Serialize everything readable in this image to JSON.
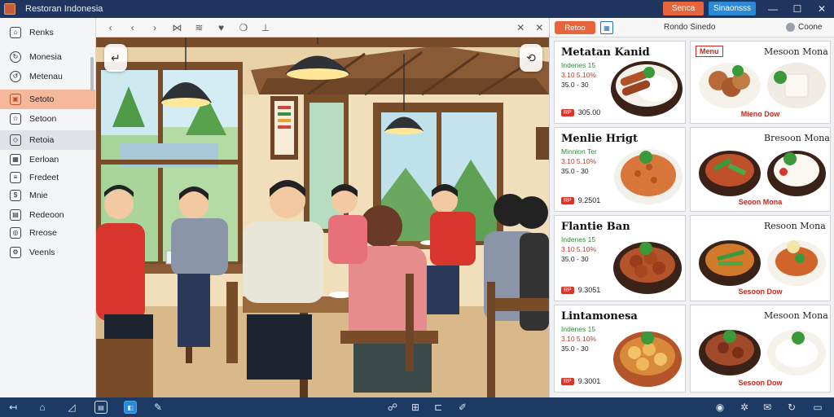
{
  "window": {
    "title": "Restoran Indonesia",
    "btn_orange": "Senca",
    "btn_blue": "Sinaonsss",
    "controls": [
      "—",
      "☐",
      "✕"
    ]
  },
  "sidebar": {
    "items": [
      {
        "label": "Renks",
        "icon": "home-icon",
        "state": "normal"
      },
      {
        "label": "Monesia",
        "icon": "refresh-icon",
        "state": "normal"
      },
      {
        "label": "Metenau",
        "icon": "reload-icon",
        "state": "normal"
      },
      {
        "label": "Setoto",
        "icon": "bag-icon",
        "state": "active"
      },
      {
        "label": "Setoon",
        "icon": "star-icon",
        "state": "normal"
      },
      {
        "label": "Retoia",
        "icon": "tag-icon",
        "state": "hover"
      },
      {
        "label": "Eerloan",
        "icon": "grid-icon",
        "state": "normal"
      },
      {
        "label": "Fredeet",
        "icon": "document-icon",
        "state": "normal"
      },
      {
        "label": "Mnie",
        "icon": "dollar-icon",
        "state": "normal"
      },
      {
        "label": "Redeoon",
        "icon": "calendar-icon",
        "state": "normal"
      },
      {
        "label": "Rreose",
        "icon": "user-icon",
        "state": "normal"
      },
      {
        "label": "Veenls",
        "icon": "settings-icon",
        "state": "normal"
      }
    ]
  },
  "center_toolbar": {
    "icons": [
      "back-arrow-icon",
      "chevron-left-icon",
      "chevron-right-icon",
      "split-icon",
      "equals-icon",
      "heart-icon",
      "chat-icon",
      "pin-icon"
    ],
    "right_icons": [
      "close-x-icon",
      "close-icon"
    ]
  },
  "scene": {
    "alt_label": "Indonesian restaurant interior illustration"
  },
  "right_panel": {
    "toolbar": {
      "pill": "Retoo",
      "title": "Rondo Sinedo",
      "right": "Coone"
    },
    "cards": [
      {
        "col": "left",
        "name": "Metatan Kanid",
        "desc1": "Indenes 15",
        "desc2": "3.10 5.10%",
        "desc3": "35.0 - 30",
        "price": "305.00"
      },
      {
        "col": "right",
        "tag": "Menu",
        "subname": "Mesoon Mona",
        "stamp": "Mieno Dow"
      },
      {
        "col": "left",
        "name": "Menlie Hrigt",
        "desc1": "Minnion Ter",
        "desc2": "3.10 5.10%",
        "desc3": "35.0 - 30",
        "price": "9.2501"
      },
      {
        "col": "right",
        "subname": "Bresoon Mona",
        "stamp": "Seoon Mona"
      },
      {
        "col": "left",
        "name": "Flantie Ban",
        "desc1": "Indenes 15",
        "desc2": "3.10 5.10%",
        "desc3": "35.0 - 30",
        "price": "9.3051"
      },
      {
        "col": "right",
        "subname": "Resoon Mona",
        "stamp": "Sesoon Dow"
      },
      {
        "col": "left",
        "name": "Lintamonesa",
        "desc1": "Indenes 15",
        "desc2": "3.10 5.10%",
        "desc3": "35.0 - 30",
        "price": "9.3001"
      },
      {
        "col": "right",
        "subname": "Mesoon Mona",
        "stamp": "Sesoon Dow"
      }
    ]
  },
  "taskbar": {
    "left_icons": [
      "back-icon",
      "home-icon",
      "window-icon",
      "document-icon",
      "browser-icon",
      "pen-icon"
    ],
    "center_icons": [
      "chat-icon",
      "grid-icon",
      "link-icon",
      "edit-icon"
    ],
    "right_icons": [
      "globe-icon",
      "settings-icon",
      "notes-icon",
      "refresh-icon",
      "battery-icon"
    ]
  }
}
